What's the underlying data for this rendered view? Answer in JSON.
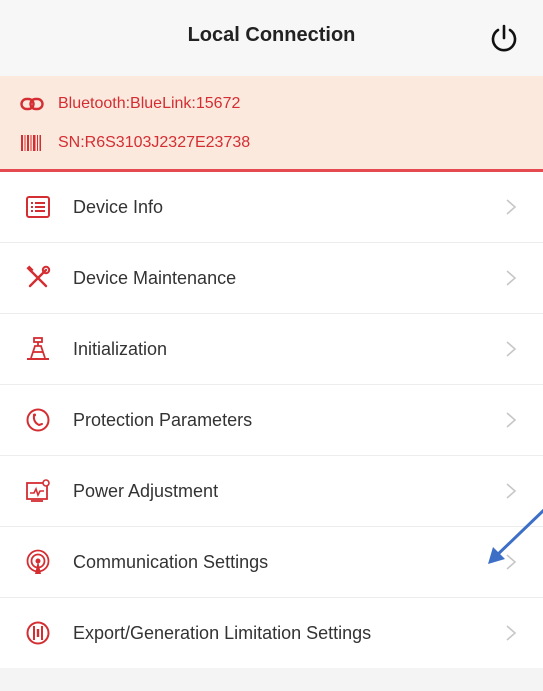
{
  "header": {
    "title": "Local Connection",
    "power_icon": "power-icon"
  },
  "connection": {
    "bluetooth": "Bluetooth:BlueLink:15672",
    "serial": "SN:R6S3103J2327E23738",
    "accent_color": "#d42e33",
    "banner_bg": "#fbe9de"
  },
  "menu": {
    "items": [
      {
        "label": "Device Info",
        "icon": "device-info-icon"
      },
      {
        "label": "Device Maintenance",
        "icon": "maintenance-tools-icon"
      },
      {
        "label": "Initialization",
        "icon": "initialization-icon"
      },
      {
        "label": "Protection Parameters",
        "icon": "protection-icon"
      },
      {
        "label": "Power Adjustment",
        "icon": "power-adjustment-icon"
      },
      {
        "label": "Communication Settings",
        "icon": "communication-icon"
      },
      {
        "label": "Export/Generation Limitation Settings",
        "icon": "export-limitation-icon"
      }
    ]
  },
  "annotation": {
    "arrow_color": "#3d6fc6"
  }
}
